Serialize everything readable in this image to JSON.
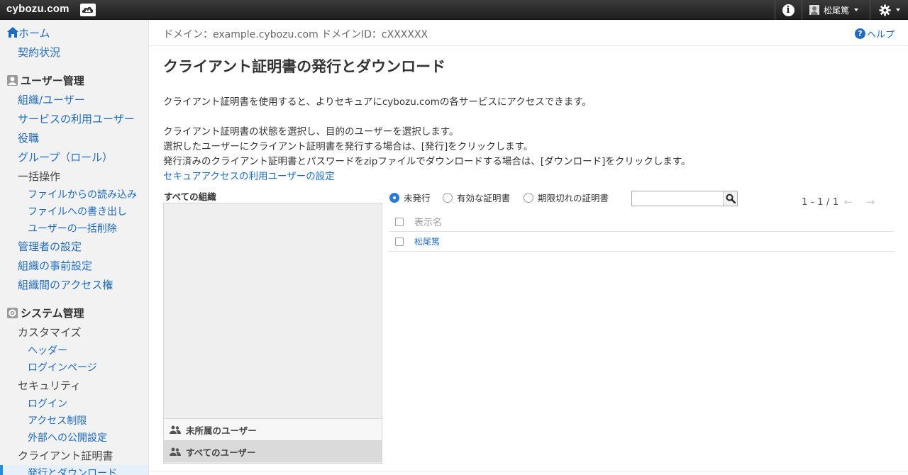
{
  "topbar": {
    "brand": "cybozu.com",
    "logo_icon": "cybozu-cloud-logo-icon",
    "info_icon": "info-icon",
    "user_name": "松尾篤",
    "settings_icon": "gear-icon"
  },
  "sidebar": {
    "home": "ホーム",
    "contract": "契約状況",
    "user_mgmt_heading": "ユーザー管理",
    "org_users": "組織/ユーザー",
    "service_users": "サービスの利用ユーザー",
    "positions": "役職",
    "groups": "グループ（ロール）",
    "bulk_ops": "一括操作",
    "import_file": "ファイルからの読み込み",
    "export_file": "ファイルへの書き出し",
    "bulk_delete": "ユーザーの一括削除",
    "admin_settings": "管理者の設定",
    "org_presettings": "組織の事前設定",
    "inter_org_access": "組織間のアクセス権",
    "system_mgmt_heading": "システム管理",
    "customize": "カスタマイズ",
    "header": "ヘッダー",
    "login_page": "ログインページ",
    "security": "セキュリティ",
    "login": "ログイン",
    "access_restriction": "アクセス制限",
    "external_publish": "外部への公開設定",
    "client_cert": "クライアント証明書",
    "issue_download": "発行とダウンロード"
  },
  "domainbar": {
    "domain": "ドメイン：example.cybozu.com",
    "domain_id": "ドメインID：cXXXXXX",
    "help": "ヘルプ"
  },
  "main": {
    "title": "クライアント証明書の発行とダウンロード",
    "desc1": "クライアント証明書を使用すると、よりセキュアにcybozu.comの各サービスにアクセスできます。",
    "desc2": "クライアント証明書の状態を選択し、目的のユーザーを選択します。",
    "desc3": "選択したユーザーにクライアント証明書を発行する場合は、[発行]をクリックします。",
    "desc4": "発行済みのクライアント証明書とパスワードをzipファイルでダウンロードする場合は、[ダウンロード]をクリックします。",
    "secure_access_link": "セキュアアクセスの利用ユーザーの設定"
  },
  "org": {
    "label": "すべての組織",
    "unassigned": "未所属のユーザー",
    "all_users": "すべてのユーザー"
  },
  "filters": {
    "options": [
      "未発行",
      "有効な証明書",
      "期限切れの証明書"
    ],
    "selected": "未発行",
    "search_value": ""
  },
  "pager": {
    "text": "1 - 1 / 1"
  },
  "table": {
    "header": "表示名",
    "rows": [
      "松尾篤"
    ]
  }
}
